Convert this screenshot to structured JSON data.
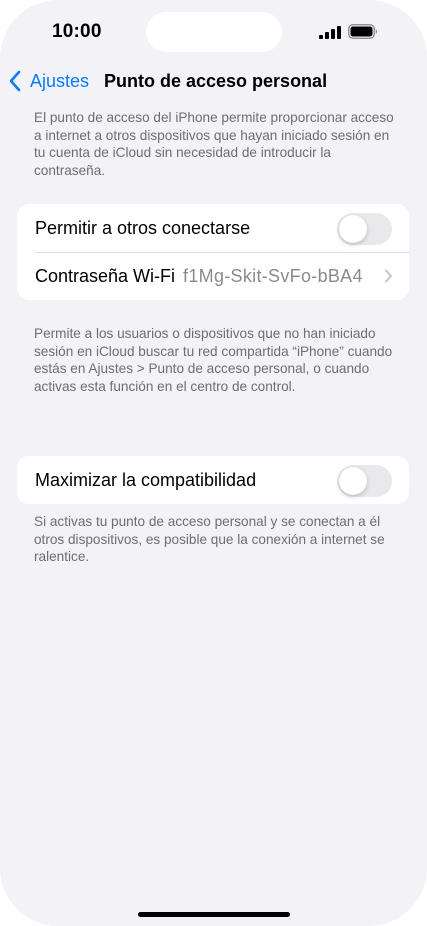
{
  "status_bar": {
    "time": "10:00",
    "icons": [
      "signal-icon",
      "battery-icon"
    ]
  },
  "nav": {
    "back_label": "Ajustes",
    "title": "Punto de acceso personal",
    "back_icon": "chevron-left-icon"
  },
  "intro_text": "El punto de acceso del iPhone permite proporcionar acceso a internet a otros dispositivos que hayan iniciado sesión en tu cuenta de iCloud sin necesidad de introducir la contraseña.",
  "settings": {
    "allow_others": {
      "label": "Permitir a otros conectarse",
      "enabled": false
    },
    "wifi_password": {
      "label": "Contraseña Wi-Fi",
      "value": "f1Mg-Skit-SvFo-bBA4"
    }
  },
  "family_text": "Permite a los usuarios o dispositivos que no han iniciado sesión en iCloud buscar tu red compartida “iPhone” cuando estás en Ajustes > Punto de acceso personal, o cuando activas esta función en el centro de control.",
  "compatibility": {
    "label": "Maximizar la compatibilidad",
    "enabled": false
  },
  "compat_text": "Si activas tu punto de acceso personal y se conectan a él otros dispositivos, es posible que la conexión a internet se ralentice.",
  "colors": {
    "accent": "#0a7aff",
    "background": "#f2f2f7",
    "toggle_off": "#e9e9eb"
  }
}
